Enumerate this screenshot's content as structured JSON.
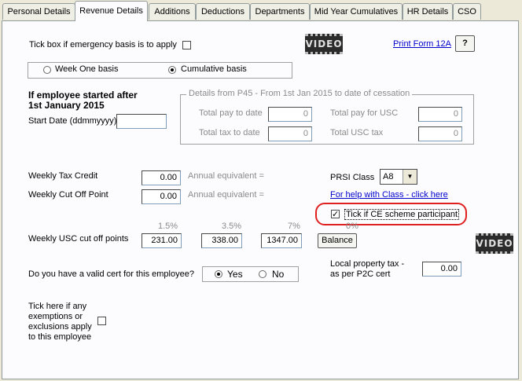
{
  "tabs": [
    "Personal Details",
    "Revenue Details",
    "Additions",
    "Deductions",
    "Departments",
    "Mid Year Cumulatives",
    "HR Details",
    "CSO"
  ],
  "emergency": {
    "label": "Tick box if emergency basis is to apply",
    "checked": false
  },
  "video_label": "VIDEO",
  "print_link": "Print Form 12A",
  "help_button": "?",
  "basis": {
    "week_one": "Week One basis",
    "cumulative": "Cumulative basis",
    "selected": "cumulative"
  },
  "start": {
    "heading_line1": "If employee started after",
    "heading_line2": "1st January 2015",
    "date_label": "Start Date (ddmmyyyy)",
    "date_value": ""
  },
  "p45": {
    "title": "Details from P45 - From 1st Jan 2015 to date of cessation",
    "total_pay_label": "Total pay to date",
    "total_pay": "0",
    "total_tax_label": "Total tax to date",
    "total_tax": "0",
    "pay_usc_label": "Total pay for USC",
    "pay_usc": "0",
    "usc_tax_label": "Total USC tax",
    "usc_tax": "0"
  },
  "tax": {
    "credit_label": "Weekly Tax Credit",
    "credit": "0.00",
    "cutoff_label": "Weekly Cut Off Point",
    "cutoff": "0.00",
    "annual_eq_label": "Annual equivalent ="
  },
  "prsi": {
    "label": "PRSI Class",
    "value": "A8",
    "help_link": "For help with Class - click here"
  },
  "ce": {
    "label": "Tick if CE scheme participant",
    "checked": true,
    "pct_hint": "0%"
  },
  "usc": {
    "label": "Weekly USC cut off points",
    "rates": [
      "1.5%",
      "3.5%",
      "7%"
    ],
    "values": [
      "231.00",
      "338.00",
      "1347.00"
    ],
    "balance_label": "Balance"
  },
  "cert": {
    "question": "Do you have a valid cert for this employee?",
    "yes": "Yes",
    "no": "No",
    "selected": "yes"
  },
  "lpt": {
    "line1": "Local property tax -",
    "line2": "as per P2C cert",
    "value": "0.00"
  },
  "exemptions": {
    "lines": [
      "Tick here if any",
      "exemptions or",
      "exclusions apply",
      "to this employee"
    ],
    "checked": false
  }
}
